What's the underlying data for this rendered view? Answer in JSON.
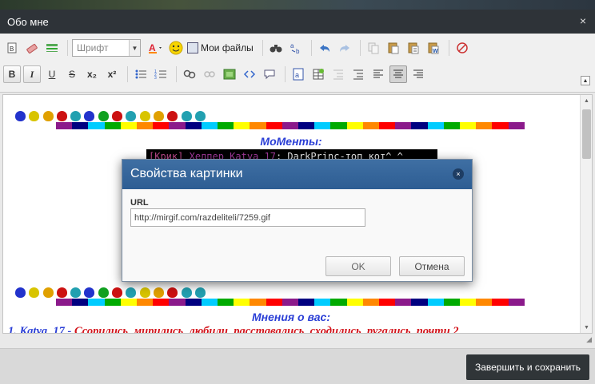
{
  "window": {
    "title": "Обо мне",
    "close_icon": "×"
  },
  "toolbar": {
    "font_select": {
      "placeholder": "Шрифт",
      "arrow": "▼"
    },
    "my_files_label": "Мои файлы",
    "bold": "B",
    "italic": "I",
    "underline": "U",
    "strike": "S",
    "subscript": "x₂",
    "superscript": "x²",
    "collapse_icon": "▲"
  },
  "editor": {
    "heading_moments": "МоМенты:",
    "chat": {
      "tag": "[Крик]",
      "nick": "Хелпер Katya_17",
      "message": ": DarkPrinc-топ кот^_^"
    },
    "heading_opinions": "Мнения о вас:",
    "opinion_author": "1. Katya_17 - ",
    "opinion_text": "Ссорились, мирились, любили, расставались, сходились, ругались, почти 2",
    "paw_colors": [
      "#2233cc",
      "#d8c400",
      "#e0a000",
      "#cc1111",
      "#22a0b0",
      "#2233cc",
      "#10a020",
      "#cc1111",
      "#22a0b0",
      "#d8c400",
      "#e0a000",
      "#cc1111",
      "#22a0b0",
      "#22a0b0"
    ],
    "rainbow_colors": [
      "#8b1a8b",
      "#000080",
      "#00ccff",
      "#00aa00",
      "#ffff00",
      "#ff8800",
      "#ff0000",
      "#8b1a8b",
      "#000080",
      "#00ccff",
      "#00aa00",
      "#ffff00",
      "#ff8800",
      "#ff0000",
      "#8b1a8b",
      "#000080",
      "#00ccff",
      "#00aa00",
      "#ffff00",
      "#ff8800",
      "#ff0000",
      "#8b1a8b",
      "#000080",
      "#00ccff",
      "#00aa00",
      "#ffff00",
      "#ff8800",
      "#ff0000",
      "#8b1a8b"
    ]
  },
  "dialog": {
    "title": "Свойства картинки",
    "url_label": "URL",
    "url_value": "http://mirgif.com/razdeliteli/7259.gif",
    "ok_label": "OK",
    "cancel_label": "Отмена",
    "close_icon": "×"
  },
  "footer": {
    "save_label": "Завершить и сохранить"
  }
}
